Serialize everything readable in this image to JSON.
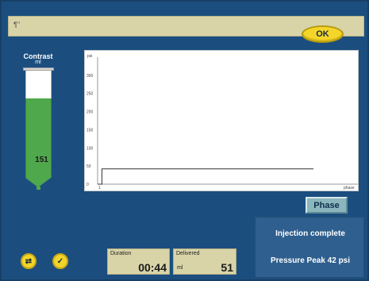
{
  "message_bar": {
    "mark": "¶\""
  },
  "ok_button": {
    "label": "OK"
  },
  "contrast": {
    "title": "Contrast",
    "unit": "ml",
    "value": "151"
  },
  "chart_data": {
    "type": "line",
    "xlabel": "phase",
    "ylabel": "psi",
    "y_ticks": [
      "300",
      "250",
      "200",
      "150",
      "100",
      "50",
      "0"
    ],
    "x_ticks": [
      "1"
    ],
    "ylim": [
      0,
      350
    ],
    "series": [
      {
        "x": [
          0,
          0.02,
          0.02,
          1.0
        ],
        "y": [
          0,
          0,
          42,
          42
        ]
      }
    ]
  },
  "phase_button": {
    "label": "Phase"
  },
  "status": {
    "line1": "Injection complete",
    "line2": "Pressure Peak  42 psi"
  },
  "duration": {
    "title": "Duration",
    "value": "00:44"
  },
  "delivered": {
    "title": "Delivered",
    "unit": "ml",
    "value": "51"
  },
  "controls": {
    "left_icon": "swap-arrows-icon",
    "right_icon": "checkmark-icon"
  }
}
